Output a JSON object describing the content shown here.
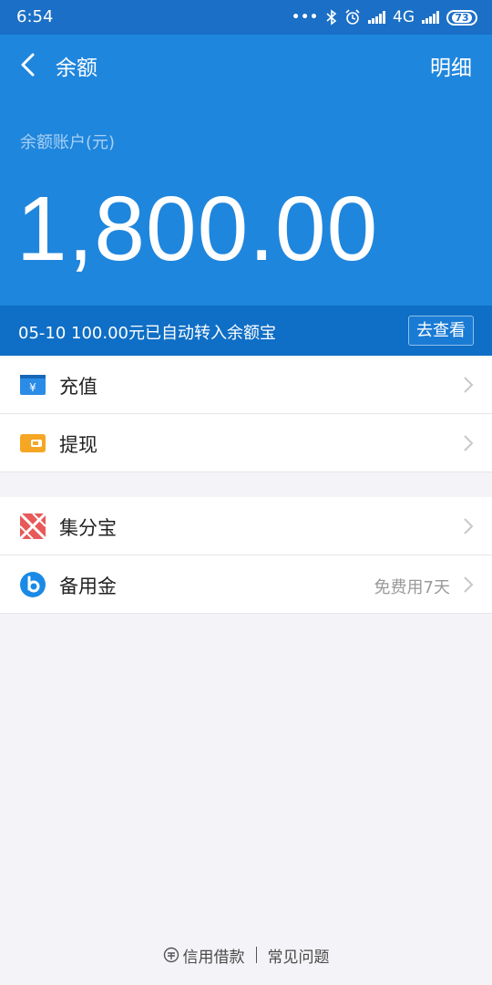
{
  "status_bar": {
    "time": "6:54",
    "network": "4G",
    "battery": "73"
  },
  "header": {
    "title": "余额",
    "detail_link": "明细",
    "account_label": "余额账户(元)",
    "balance": "1,800.00"
  },
  "notice": {
    "text": "05-10 100.00元已自动转入余额宝",
    "button": "去查看"
  },
  "menu": {
    "group1": [
      {
        "label": "充值",
        "icon": "recharge-icon"
      },
      {
        "label": "提现",
        "icon": "withdraw-icon"
      }
    ],
    "group2": [
      {
        "label": "集分宝",
        "icon": "jifenbao-icon"
      },
      {
        "label": "备用金",
        "icon": "reserve-fund-icon",
        "sub": "免费用7天"
      }
    ]
  },
  "footer": {
    "link1": "信用借款",
    "link2": "常见问题"
  },
  "colors": {
    "header_bg": "#1f86dd",
    "notice_bg": "#0f6ec5",
    "page_bg": "#f4f4f8"
  }
}
